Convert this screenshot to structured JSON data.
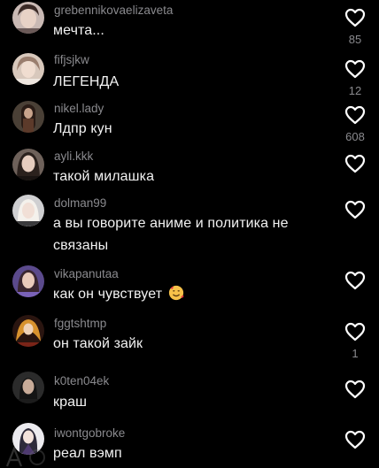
{
  "comments": [
    {
      "username": "grebennikovaelizaveta",
      "text": "мечта...",
      "likes": "85"
    },
    {
      "username": "fifjsjkw",
      "text": "ЛЕГЕНДА",
      "likes": "12"
    },
    {
      "username": "nikel.lady",
      "text": "Лдпр кун",
      "likes": "608"
    },
    {
      "username": "ayli.kkk",
      "text": "такой милашка",
      "likes": ""
    },
    {
      "username": "dolman99",
      "text": "а вы говорите аниме и политика не связаны",
      "likes": ""
    },
    {
      "username": "vikapanutaa",
      "text": "как он чувствует",
      "likes": "",
      "emoji": "smiling-face-with-hearts"
    },
    {
      "username": "fggtshtmp",
      "text": "он такой зайк",
      "likes": "1"
    },
    {
      "username": "k0ten04ek",
      "text": "краш",
      "likes": ""
    },
    {
      "username": "iwontgobroke",
      "text": "реал вэмп",
      "likes": ""
    }
  ],
  "icons": {
    "like": "heart-outline-icon"
  },
  "colors": {
    "background": "#000000",
    "username": "#8a8a8e",
    "text": "#f2f2f2",
    "icon": "#ffffff"
  }
}
